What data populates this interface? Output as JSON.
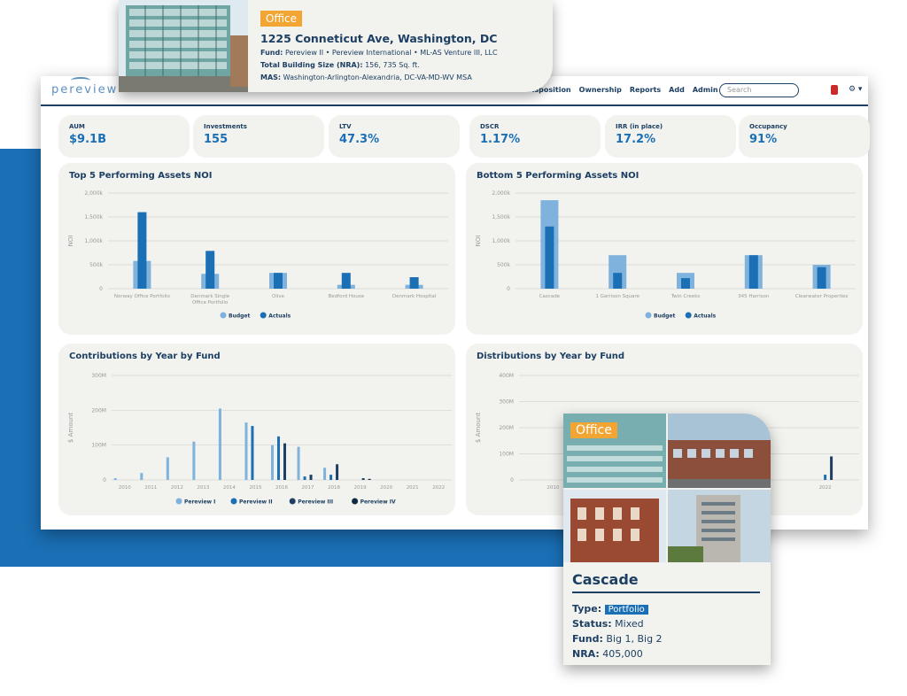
{
  "app": {
    "logo": "pereview",
    "nav": [
      "Disposition",
      "Ownership",
      "Reports",
      "Add",
      "Admin"
    ],
    "search_placeholder": "Search"
  },
  "property_card": {
    "badge": "Office",
    "address": "1225 Conneticut Ave, Washington, DC",
    "fund_label": "Fund:",
    "fund_value": "Pereview II • Pereview International • ML-AS Venture III, LLC",
    "size_label": "Total Building Size (NRA):",
    "size_value": "156, 735 Sq. ft.",
    "mas_label": "MAS:",
    "mas_value": "Washington-Arlington-Alexandria, DC-VA-MD-WV MSA"
  },
  "kpis": [
    {
      "label": "AUM",
      "value": "$9.1B"
    },
    {
      "label": "Investments",
      "value": "155"
    },
    {
      "label": "LTV",
      "value": "47.3%"
    },
    {
      "label": "DSCR",
      "value": "1.17%"
    },
    {
      "label": "IRR (in place)",
      "value": "17.2%"
    },
    {
      "label": "Occupancy",
      "value": "91%"
    }
  ],
  "panels": {
    "top5": "Top 5 Performing Assets NOI",
    "bottom5": "Bottom 5 Performing Assets NOI",
    "contrib": "Contributions by Year by Fund",
    "distrib": "Distributions by Year by Fund"
  },
  "portfolio_card": {
    "badge": "Office",
    "title": "Cascade",
    "type_label": "Type:",
    "type_value": "Portfolio",
    "status_label": "Status:",
    "status_value": "Mixed",
    "fund_label": "Fund:",
    "fund_value": "Big 1, Big 2",
    "nra_label": "NRA:",
    "nra_value": "405,000"
  },
  "colors": {
    "navy": "#1c3f63",
    "blue": "#1a6fb5",
    "light_blue": "#7fb2dd",
    "dark": "#0d2b45",
    "orange": "#f3a533"
  },
  "chart_data": [
    {
      "type": "bar",
      "title": "Top 5 Performing Assets NOI",
      "ylabel": "NOI",
      "yticks": [
        "2,000k",
        "1,500k",
        "1,000k",
        "500k",
        "0"
      ],
      "ylim": [
        0,
        2000
      ],
      "categories": [
        "Norway Office Portfolio",
        "Denmark Single Office Portfolio",
        "Olive",
        "Bedford House",
        "Denmark Hospital"
      ],
      "series": [
        {
          "name": "Budget",
          "values": [
            580,
            310,
            330,
            80,
            80
          ]
        },
        {
          "name": "Actuals",
          "values": [
            1600,
            790,
            330,
            330,
            240
          ]
        }
      ]
    },
    {
      "type": "bar",
      "title": "Bottom 5 Performing Assets NOI",
      "ylabel": "NOI",
      "yticks": [
        "2,000k",
        "1,500k",
        "1,000k",
        "500k",
        "0"
      ],
      "ylim": [
        0,
        2000
      ],
      "categories": [
        "Cascade",
        "1 Garrison Square",
        "Twin Creeks",
        "345 Harrison",
        "Clearwater Properties"
      ],
      "series": [
        {
          "name": "Budget",
          "values": [
            1850,
            700,
            330,
            700,
            500
          ]
        },
        {
          "name": "Actuals",
          "values": [
            1300,
            330,
            220,
            700,
            450
          ]
        }
      ]
    },
    {
      "type": "bar",
      "title": "Contributions by Year by Fund",
      "ylabel": "$ Amount",
      "yticks": [
        "300M",
        "200M",
        "100M",
        "0"
      ],
      "ylim": [
        0,
        300
      ],
      "categories": [
        "2010",
        "2011",
        "2012",
        "2013",
        "2014",
        "2015",
        "2016",
        "2017",
        "2018",
        "2019",
        "2020",
        "2021",
        "2022"
      ],
      "series": [
        {
          "name": "Pereview I",
          "values": [
            5,
            20,
            65,
            110,
            205,
            165,
            100,
            95,
            35,
            0,
            0,
            0,
            0
          ]
        },
        {
          "name": "Pereview II",
          "values": [
            0,
            0,
            0,
            0,
            0,
            155,
            125,
            10,
            15,
            0,
            0,
            0,
            0
          ]
        },
        {
          "name": "Pereview III",
          "values": [
            0,
            0,
            0,
            0,
            0,
            0,
            105,
            15,
            45,
            5,
            0,
            0,
            0
          ]
        },
        {
          "name": "Pereview IV",
          "values": [
            0,
            0,
            0,
            0,
            0,
            0,
            0,
            0,
            0,
            3,
            0,
            0,
            0
          ]
        }
      ]
    },
    {
      "type": "bar",
      "title": "Distributions by Year by Fund",
      "ylabel": "$ Amount",
      "yticks": [
        "400M",
        "300M",
        "200M",
        "100M",
        "0"
      ],
      "ylim": [
        0,
        400
      ],
      "categories": [
        "2010",
        "2011",
        "2020",
        "2021",
        "2022"
      ],
      "series": [
        {
          "name": "Pereview I",
          "values": [
            0,
            0,
            0,
            0,
            0
          ]
        },
        {
          "name": "Pereview II",
          "values": [
            0,
            0,
            25,
            35,
            20
          ]
        },
        {
          "name": "Pereview III",
          "values": [
            0,
            0,
            25,
            75,
            90
          ]
        }
      ]
    }
  ]
}
